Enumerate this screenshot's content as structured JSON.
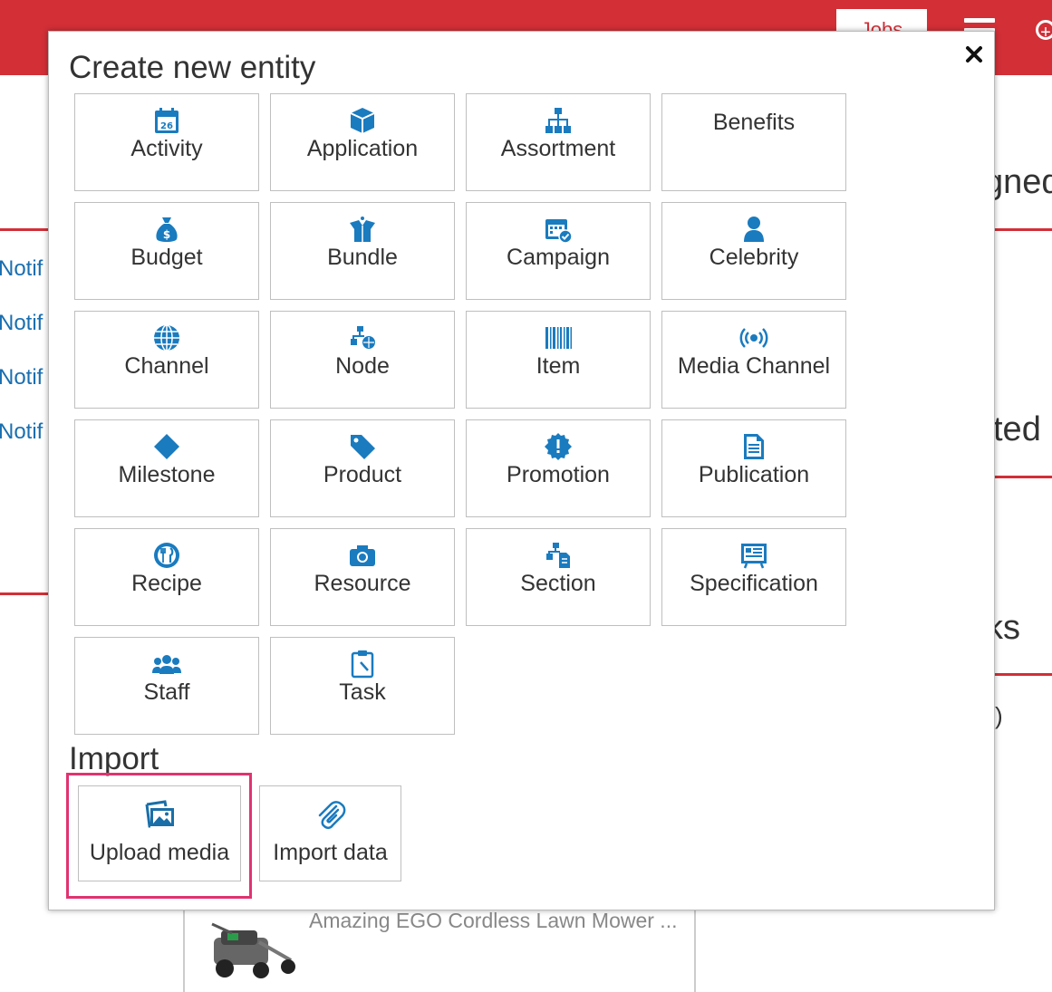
{
  "colors": {
    "accent": "#d22f37",
    "icon_blue": "#1a7bbf",
    "highlight": "#e0336f"
  },
  "header": {
    "jobs_label": "Jobs"
  },
  "background": {
    "notifications": [
      "Notif",
      "Notif",
      "Notif",
      "Notif"
    ],
    "frag_assigned": "gned",
    "frag_updated": "ted",
    "frag_tasks": "ks",
    "frag_paren": ")",
    "product_title": "Amazing EGO Cordless Lawn Mower ..."
  },
  "modal": {
    "title": "Create new entity",
    "entities": [
      {
        "label": "Activity",
        "icon": "calendar-icon"
      },
      {
        "label": "Application",
        "icon": "cube-icon"
      },
      {
        "label": "Assortment",
        "icon": "sitemap-icon"
      },
      {
        "label": "Benefits",
        "icon": ""
      },
      {
        "label": "Budget",
        "icon": "money-bag-icon"
      },
      {
        "label": "Bundle",
        "icon": "open-box-icon"
      },
      {
        "label": "Campaign",
        "icon": "calendar-check-icon"
      },
      {
        "label": "Celebrity",
        "icon": "person-icon"
      },
      {
        "label": "Channel",
        "icon": "globe-icon"
      },
      {
        "label": "Node",
        "icon": "node-icon"
      },
      {
        "label": "Item",
        "icon": "barcode-icon"
      },
      {
        "label": "Media Channel",
        "icon": "broadcast-icon"
      },
      {
        "label": "Milestone",
        "icon": "diamond-icon"
      },
      {
        "label": "Product",
        "icon": "tag-icon"
      },
      {
        "label": "Promotion",
        "icon": "badge-icon"
      },
      {
        "label": "Publication",
        "icon": "document-icon"
      },
      {
        "label": "Recipe",
        "icon": "cutlery-icon"
      },
      {
        "label": "Resource",
        "icon": "camera-icon"
      },
      {
        "label": "Section",
        "icon": "section-icon"
      },
      {
        "label": "Specification",
        "icon": "spec-sheet-icon"
      },
      {
        "label": "Staff",
        "icon": "group-icon"
      },
      {
        "label": "Task",
        "icon": "clipboard-icon"
      }
    ],
    "import_title": "Import",
    "imports": [
      {
        "label": "Upload media",
        "icon": "images-icon"
      },
      {
        "label": "Import data",
        "icon": "paperclip-icon"
      }
    ]
  }
}
